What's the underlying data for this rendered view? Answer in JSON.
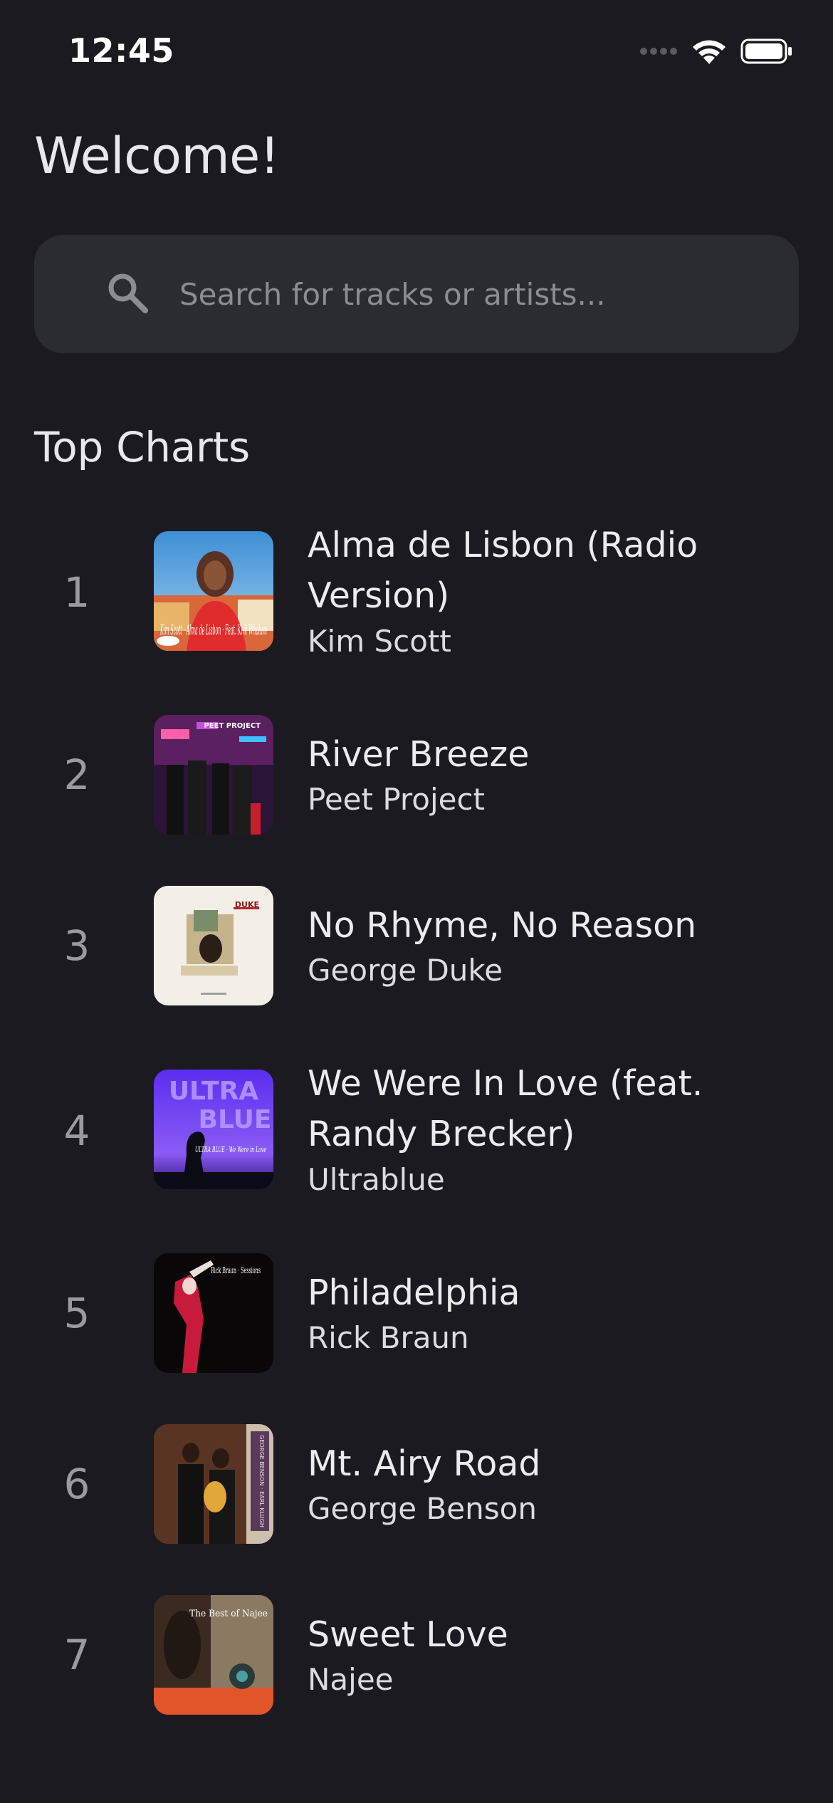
{
  "status_bar": {
    "time": "12:45",
    "icons": [
      "signal-dots-icon",
      "wifi-icon",
      "battery-icon"
    ]
  },
  "header": {
    "title": "Welcome!"
  },
  "search": {
    "placeholder": "Search for tracks or artists...",
    "value": "",
    "icon": "search-icon"
  },
  "section": {
    "title": "Top Charts"
  },
  "tracks": [
    {
      "rank": "1",
      "title": "Alma de Lisbon (Radio Version)",
      "artist": "Kim Scott",
      "cover_text": "Kim Scott · Alma de Lisbon · Feat. Kirk Whalum"
    },
    {
      "rank": "2",
      "title": "River Breeze",
      "artist": "Peet Project",
      "cover_text": "PEET PROJECT"
    },
    {
      "rank": "3",
      "title": "No Rhyme, No Reason",
      "artist": "George Duke",
      "cover_text": "DUKE"
    },
    {
      "rank": "4",
      "title": "We Were In Love (feat. Randy Brecker)",
      "artist": "Ultrablue",
      "cover_text": "ULTRA BLUE · We Were in Love"
    },
    {
      "rank": "5",
      "title": "Philadelphia",
      "artist": "Rick Braun",
      "cover_text": "Rick Braun · Sessions"
    },
    {
      "rank": "6",
      "title": "Mt. Airy Road",
      "artist": "George Benson",
      "cover_text": "GEORGE BENSON · EARL KLUGH"
    },
    {
      "rank": "7",
      "title": "Sweet Love",
      "artist": "Najee",
      "cover_text": "The Best of Najee"
    }
  ],
  "colors": {
    "background": "#1b1a20",
    "search_background": "#2b2b32",
    "text_primary": "#ececef",
    "text_muted": "#9a9aa2",
    "placeholder": "#8c8c93"
  }
}
